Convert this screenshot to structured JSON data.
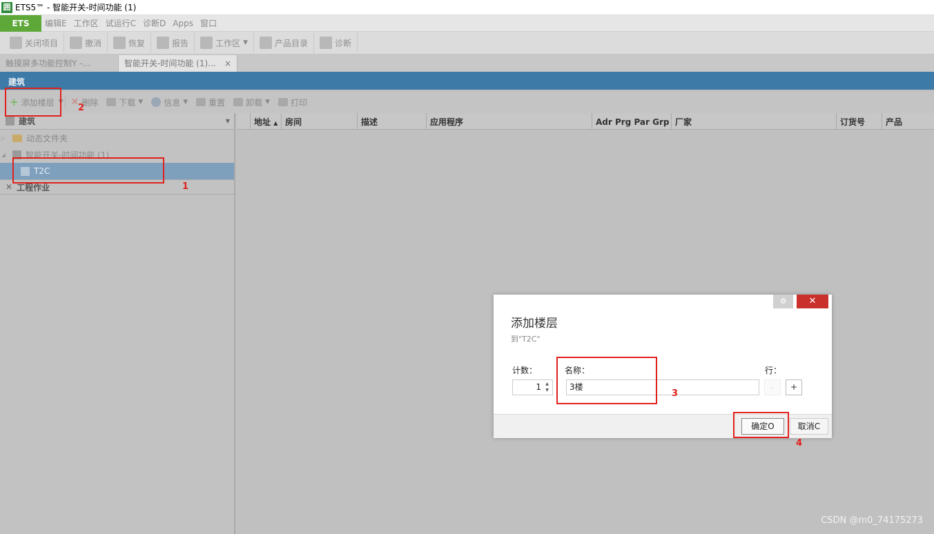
{
  "window": {
    "title": "ETS5™ - 智能开关-时间功能 (1)"
  },
  "menubar": {
    "ets_label": "ETS",
    "items": [
      "编辑E",
      "工作区",
      "试运行C",
      "诊断D",
      "Apps",
      "窗口"
    ]
  },
  "toolbar": {
    "close_project": "关闭项目",
    "undo": "撤消",
    "redo": "恢复",
    "report": "报告",
    "workspace": "工作区",
    "catalog": "产品目录",
    "diagnostics": "诊断"
  },
  "tabs": [
    {
      "label": "触摸屏多功能控制Y -..."
    },
    {
      "label": "智能开关-时间功能 (1)...",
      "close": "×"
    }
  ],
  "building_panel": {
    "header": "建筑",
    "subtoolbar": {
      "add_floor": "添加楼层",
      "delete": "删除",
      "download": "下载",
      "info": "信息",
      "reset": "重置",
      "unload": "卸载",
      "print": "打印"
    },
    "tree_header": "建筑",
    "tree": {
      "dynamic_folder": "动态文件夹",
      "project": "智能开关-时间功能 (1)",
      "selected": "T2C"
    },
    "work_section": "工程作业"
  },
  "grid": {
    "columns": [
      "地址",
      "房间",
      "描述",
      "应用程序",
      "Adr Prg Par Grp Cfg",
      "厂家",
      "订货号",
      "产品"
    ]
  },
  "dialog": {
    "title": "添加楼层",
    "subtitle": "到\"T2C\"",
    "count_label": "计数：",
    "count_value": "1",
    "name_label": "名称：",
    "name_value": "3楼",
    "row_label": "行：",
    "minus": "-",
    "plus": "+",
    "ok": "确定O",
    "cancel": "取消C",
    "close": "✕"
  },
  "annotations": {
    "step1": "1",
    "step2": "2",
    "step3": "3",
    "step4": "4",
    "color": "#e0201b"
  },
  "watermark": "CSDN @m0_74175273"
}
